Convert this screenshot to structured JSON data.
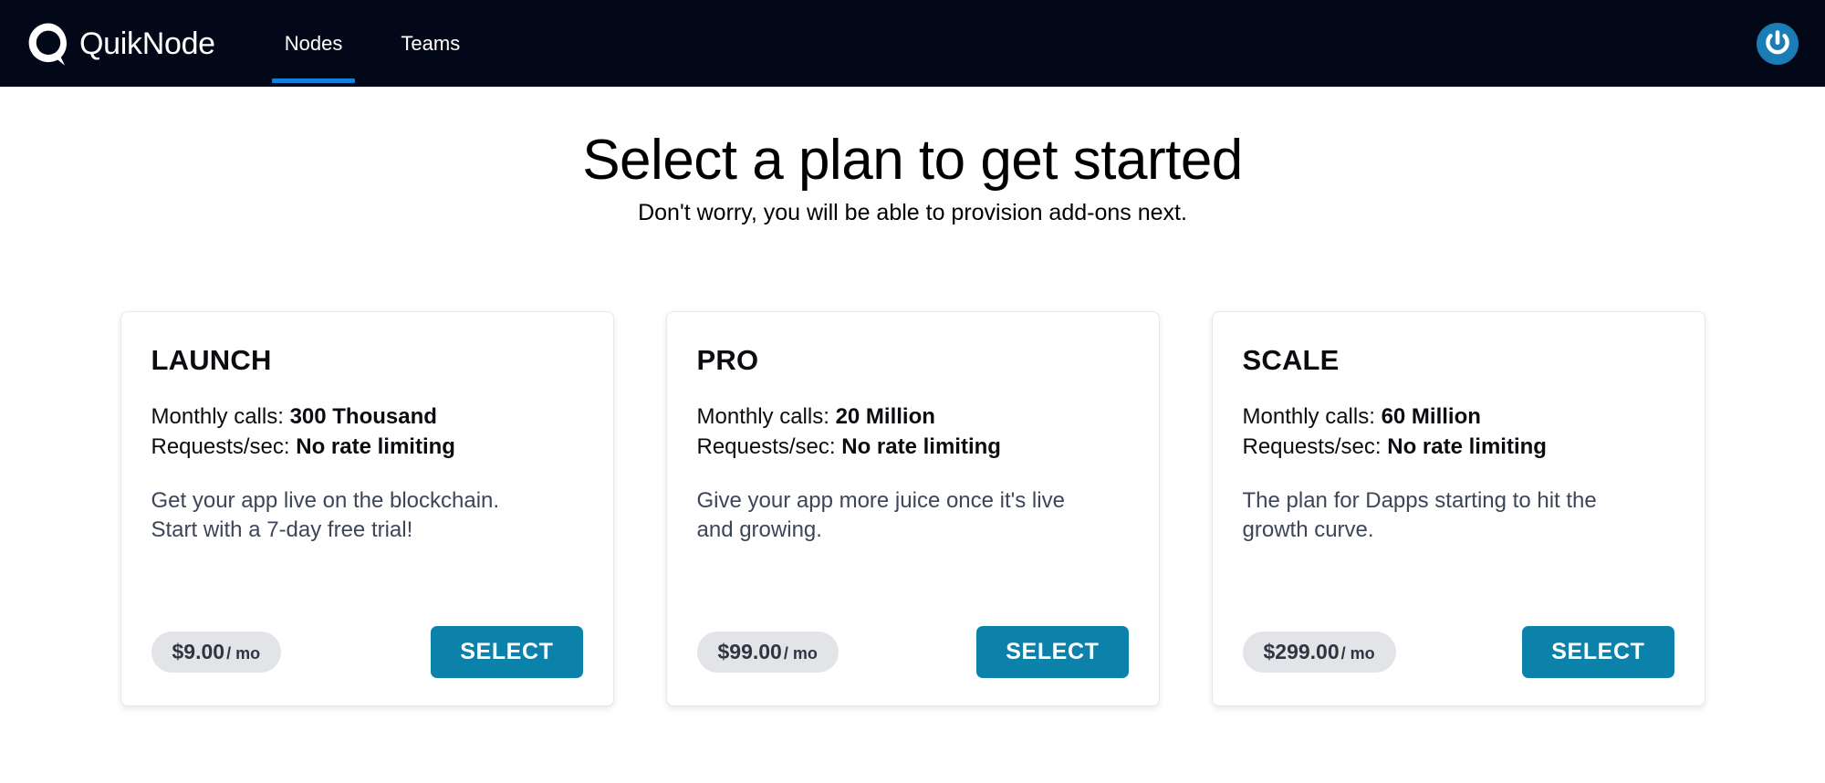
{
  "navbar": {
    "brand": {
      "logo_icon": "quiknode-q-logo",
      "name": "QuikNode"
    },
    "links": [
      {
        "label": "Nodes",
        "active": true
      },
      {
        "label": "Teams",
        "active": false
      }
    ],
    "account": {
      "avatar_icon": "gravatar-avatar-icon"
    },
    "background_color": "#030818",
    "active_underline_color": "#1180d8"
  },
  "header": {
    "title": "Select a plan to get started",
    "subtitle": "Don't worry, you will be able to provision add-ons next."
  },
  "plans": [
    {
      "name": "LAUNCH",
      "monthly_calls_label": "Monthly calls: ",
      "monthly_calls_value": "300 Thousand",
      "requests_label": "Requests/sec: ",
      "requests_value": "No rate limiting",
      "description": "Get your app live on the blockchain. Start with a 7-day free trial!",
      "price_amount": "$9.00",
      "price_period": "/ mo",
      "select_label": "SELECT"
    },
    {
      "name": "PRO",
      "monthly_calls_label": "Monthly calls: ",
      "monthly_calls_value": "20 Million",
      "requests_label": "Requests/sec: ",
      "requests_value": "No rate limiting",
      "description": "Give your app more juice once it's live and growing.",
      "price_amount": "$99.00",
      "price_period": "/ mo",
      "select_label": "SELECT"
    },
    {
      "name": "SCALE",
      "monthly_calls_label": "Monthly calls: ",
      "monthly_calls_value": "60 Million",
      "requests_label": "Requests/sec: ",
      "requests_value": "No rate limiting",
      "description": "The plan for Dapps starting to hit the growth curve.",
      "price_amount": "$299.00",
      "price_period": "/ mo",
      "select_label": "SELECT"
    }
  ],
  "colors": {
    "accent_button": "#0c82ab",
    "price_pill_bg": "#e3e4e8",
    "description_text": "#3d4659",
    "nav_bg": "#030818"
  }
}
